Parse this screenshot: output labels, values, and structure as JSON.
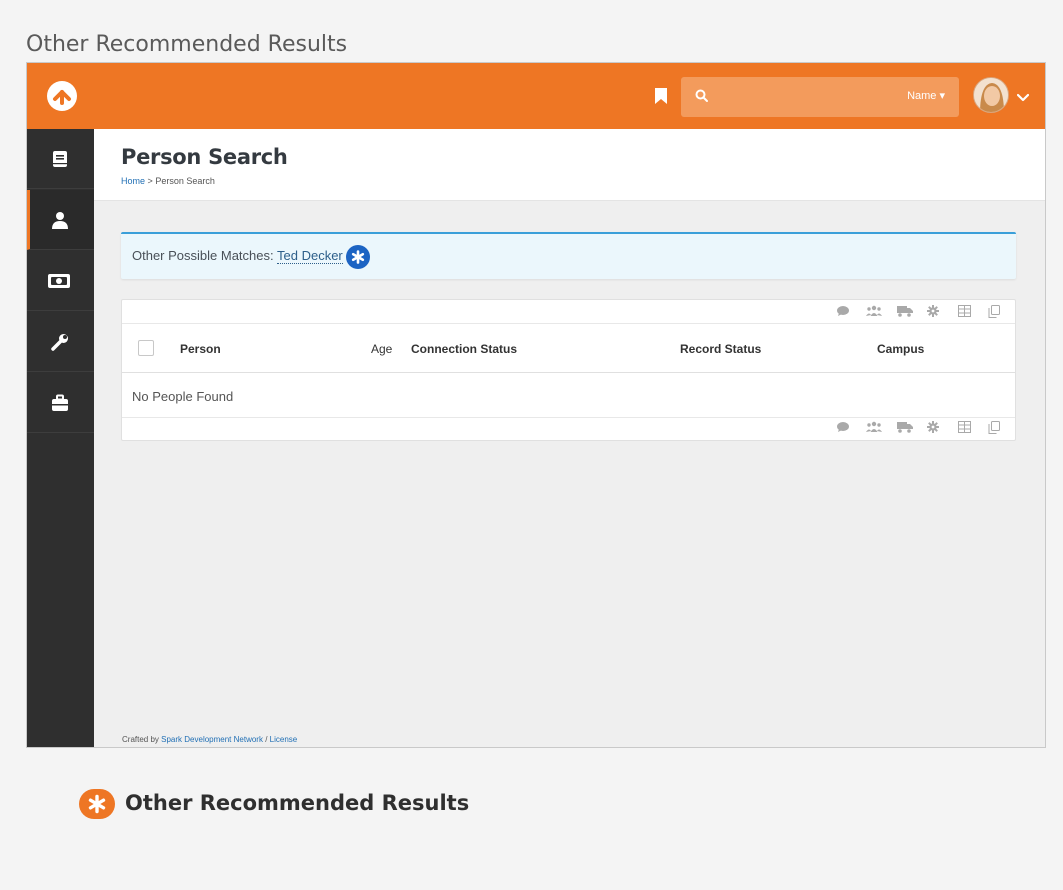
{
  "document": {
    "heading": "Other Recommended Results"
  },
  "topbar": {
    "search_placeholder": "",
    "search_type": "Name ▾"
  },
  "sidebar": {
    "items": [
      {
        "icon": "book-icon"
      },
      {
        "icon": "person-icon",
        "active": true
      },
      {
        "icon": "money-icon"
      },
      {
        "icon": "wrench-icon"
      },
      {
        "icon": "briefcase-icon"
      }
    ]
  },
  "page": {
    "title": "Person Search",
    "breadcrumb": {
      "home": "Home",
      "separator": ">",
      "current": "Person Search"
    }
  },
  "alert": {
    "label": "Other Possible Matches:",
    "match": "Ted Decker"
  },
  "grid": {
    "columns": [
      "Person",
      "Age",
      "Connection Status",
      "Record Status",
      "Campus"
    ],
    "empty_message": "No People Found",
    "actions": [
      "comment-icon",
      "group-icon",
      "truck-icon",
      "gear-icon",
      "table-icon",
      "copy-icon"
    ]
  },
  "footer": {
    "prefix": "Crafted by",
    "org": "Spark Development Network",
    "separator": "/",
    "license": "License"
  },
  "callout": {
    "text": "Other Recommended Results"
  },
  "colors": {
    "brand_orange": "#ee7624",
    "sidebar_dark": "#2f2f2f",
    "info_blue": "#3a9fd9",
    "badge_blue": "#1c64c3"
  }
}
